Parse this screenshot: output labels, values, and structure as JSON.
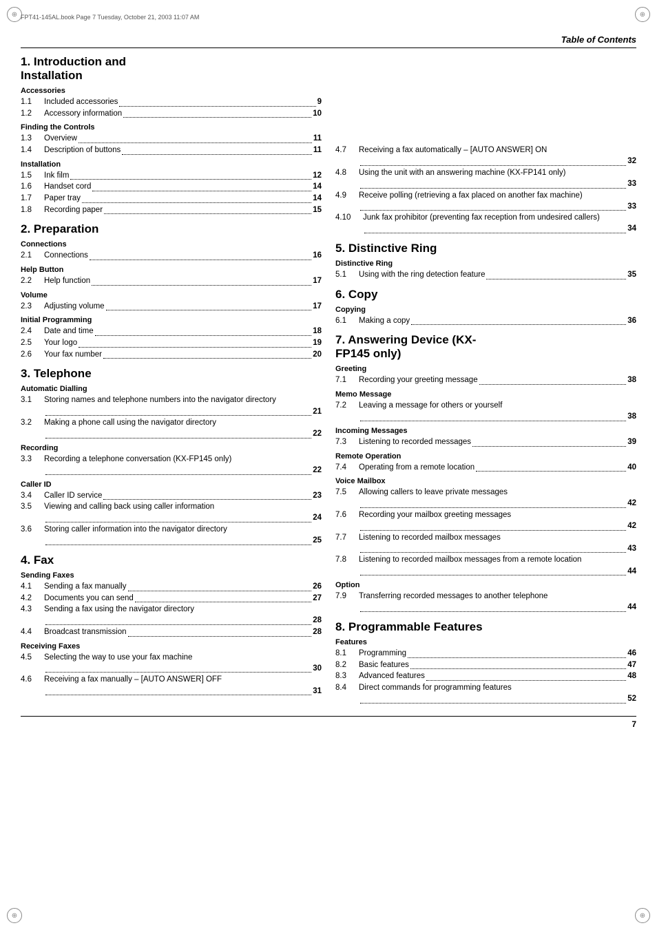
{
  "page": {
    "title": "Table of Contents",
    "file_info": "FPT41-145AL.book  Page 7  Tuesday, October 21, 2003  11:07 AM",
    "page_number": "7"
  },
  "sections": [
    {
      "id": "s1",
      "number": "1.",
      "title": "Introduction and Installation",
      "subsections": [
        {
          "id": "ss1_1",
          "title": "Accessories",
          "entries": [
            {
              "num": "1.1",
              "text": "Included accessories",
              "page": "9"
            },
            {
              "num": "1.2",
              "text": "Accessory information",
              "page": "10"
            }
          ]
        },
        {
          "id": "ss1_2",
          "title": "Finding the Controls",
          "entries": [
            {
              "num": "1.3",
              "text": "Overview",
              "page": "11"
            },
            {
              "num": "1.4",
              "text": "Description of buttons",
              "page": "11"
            }
          ]
        },
        {
          "id": "ss1_3",
          "title": "Installation",
          "entries": [
            {
              "num": "1.5",
              "text": "Ink film",
              "page": "12"
            },
            {
              "num": "1.6",
              "text": "Handset cord",
              "page": "14"
            },
            {
              "num": "1.7",
              "text": "Paper tray",
              "page": "14"
            },
            {
              "num": "1.8",
              "text": "Recording paper",
              "page": "15"
            }
          ]
        }
      ]
    },
    {
      "id": "s2",
      "number": "2.",
      "title": "Preparation",
      "subsections": [
        {
          "id": "ss2_1",
          "title": "Connections",
          "entries": [
            {
              "num": "2.1",
              "text": "Connections",
              "page": "16"
            }
          ]
        },
        {
          "id": "ss2_2",
          "title": "Help Button",
          "entries": [
            {
              "num": "2.2",
              "text": "Help function",
              "page": "17"
            }
          ]
        },
        {
          "id": "ss2_3",
          "title": "Volume",
          "entries": [
            {
              "num": "2.3",
              "text": "Adjusting volume",
              "page": "17"
            }
          ]
        },
        {
          "id": "ss2_4",
          "title": "Initial Programming",
          "entries": [
            {
              "num": "2.4",
              "text": "Date and time",
              "page": "18"
            },
            {
              "num": "2.5",
              "text": "Your logo",
              "page": "19"
            },
            {
              "num": "2.6",
              "text": "Your fax number",
              "page": "20"
            }
          ]
        }
      ]
    },
    {
      "id": "s3",
      "number": "3.",
      "title": "Telephone",
      "subsections": [
        {
          "id": "ss3_1",
          "title": "Automatic Dialling",
          "entries": [
            {
              "num": "3.1",
              "text": "Storing names and telephone numbers into the navigator directory",
              "page": "21"
            },
            {
              "num": "3.2",
              "text": "Making a phone call using the navigator directory",
              "page": "22"
            }
          ]
        },
        {
          "id": "ss3_2",
          "title": "Recording",
          "entries": [
            {
              "num": "3.3",
              "text": "Recording a telephone conversation (KX-FP145 only)",
              "page": "22"
            }
          ]
        },
        {
          "id": "ss3_3",
          "title": "Caller ID",
          "entries": [
            {
              "num": "3.4",
              "text": "Caller ID service",
              "page": "23"
            },
            {
              "num": "3.5",
              "text": "Viewing and calling back using caller information",
              "page": "24"
            },
            {
              "num": "3.6",
              "text": "Storing caller information into the navigator directory",
              "page": "25"
            }
          ]
        }
      ]
    },
    {
      "id": "s4",
      "number": "4.",
      "title": "Fax",
      "subsections": [
        {
          "id": "ss4_1",
          "title": "Sending Faxes",
          "entries": [
            {
              "num": "4.1",
              "text": "Sending a fax manually",
              "page": "26"
            },
            {
              "num": "4.2",
              "text": "Documents you can send",
              "page": "27"
            },
            {
              "num": "4.3",
              "text": "Sending a fax using the navigator directory",
              "page": "28"
            },
            {
              "num": "4.4",
              "text": "Broadcast transmission",
              "page": "28"
            }
          ]
        },
        {
          "id": "ss4_2",
          "title": "Receiving Faxes",
          "entries": [
            {
              "num": "4.5",
              "text": "Selecting the way to use your fax machine",
              "page": "30"
            },
            {
              "num": "4.6",
              "text": "Receiving a fax manually – [AUTO ANSWER] OFF",
              "page": "31"
            },
            {
              "num": "4.7",
              "text": "Receiving a fax automatically – [AUTO ANSWER] ON",
              "page": "32"
            },
            {
              "num": "4.8",
              "text": "Using the unit with an answering machine (KX-FP141 only)",
              "page": "33"
            },
            {
              "num": "4.9",
              "text": "Receive polling (retrieving a fax placed on another fax machine)",
              "page": "33"
            },
            {
              "num": "4.10",
              "text": "Junk fax prohibitor (preventing fax reception from undesired callers)",
              "page": "34"
            }
          ]
        }
      ]
    },
    {
      "id": "s5",
      "number": "5.",
      "title": "Distinctive Ring",
      "subsections": [
        {
          "id": "ss5_1",
          "title": "Distinctive Ring",
          "entries": [
            {
              "num": "5.1",
              "text": "Using with the ring detection feature",
              "page": "35"
            }
          ]
        }
      ]
    },
    {
      "id": "s6",
      "number": "6.",
      "title": "Copy",
      "subsections": [
        {
          "id": "ss6_1",
          "title": "Copying",
          "entries": [
            {
              "num": "6.1",
              "text": "Making a copy",
              "page": "36"
            }
          ]
        }
      ]
    },
    {
      "id": "s7",
      "number": "7.",
      "title": "Answering Device (KX-FP145 only)",
      "subsections": [
        {
          "id": "ss7_1",
          "title": "Greeting",
          "entries": [
            {
              "num": "7.1",
              "text": "Recording your greeting message",
              "page": "38"
            }
          ]
        },
        {
          "id": "ss7_2",
          "title": "Memo Message",
          "entries": [
            {
              "num": "7.2",
              "text": "Leaving a message for others or yourself",
              "page": "38"
            }
          ]
        },
        {
          "id": "ss7_3",
          "title": "Incoming Messages",
          "entries": [
            {
              "num": "7.3",
              "text": "Listening to recorded messages",
              "page": "39"
            }
          ]
        },
        {
          "id": "ss7_4",
          "title": "Remote Operation",
          "entries": [
            {
              "num": "7.4",
              "text": "Operating from a remote location",
              "page": "40"
            }
          ]
        },
        {
          "id": "ss7_5",
          "title": "Voice Mailbox",
          "entries": [
            {
              "num": "7.5",
              "text": "Allowing callers to leave private messages",
              "page": "42"
            },
            {
              "num": "7.6",
              "text": "Recording your mailbox greeting messages",
              "page": "42"
            },
            {
              "num": "7.7",
              "text": "Listening to recorded mailbox messages",
              "page": "43"
            },
            {
              "num": "7.8",
              "text": "Listening to recorded mailbox messages from a remote location",
              "page": "44"
            }
          ]
        },
        {
          "id": "ss7_6",
          "title": "Option",
          "entries": [
            {
              "num": "7.9",
              "text": "Transferring recorded messages to another telephone",
              "page": "44"
            }
          ]
        }
      ]
    },
    {
      "id": "s8",
      "number": "8.",
      "title": "Programmable Features",
      "subsections": [
        {
          "id": "ss8_1",
          "title": "Features",
          "entries": [
            {
              "num": "8.1",
              "text": "Programming",
              "page": "46"
            },
            {
              "num": "8.2",
              "text": "Basic features",
              "page": "47"
            },
            {
              "num": "8.3",
              "text": "Advanced features",
              "page": "48"
            },
            {
              "num": "8.4",
              "text": "Direct commands for programming features",
              "page": "52"
            }
          ]
        }
      ]
    }
  ]
}
